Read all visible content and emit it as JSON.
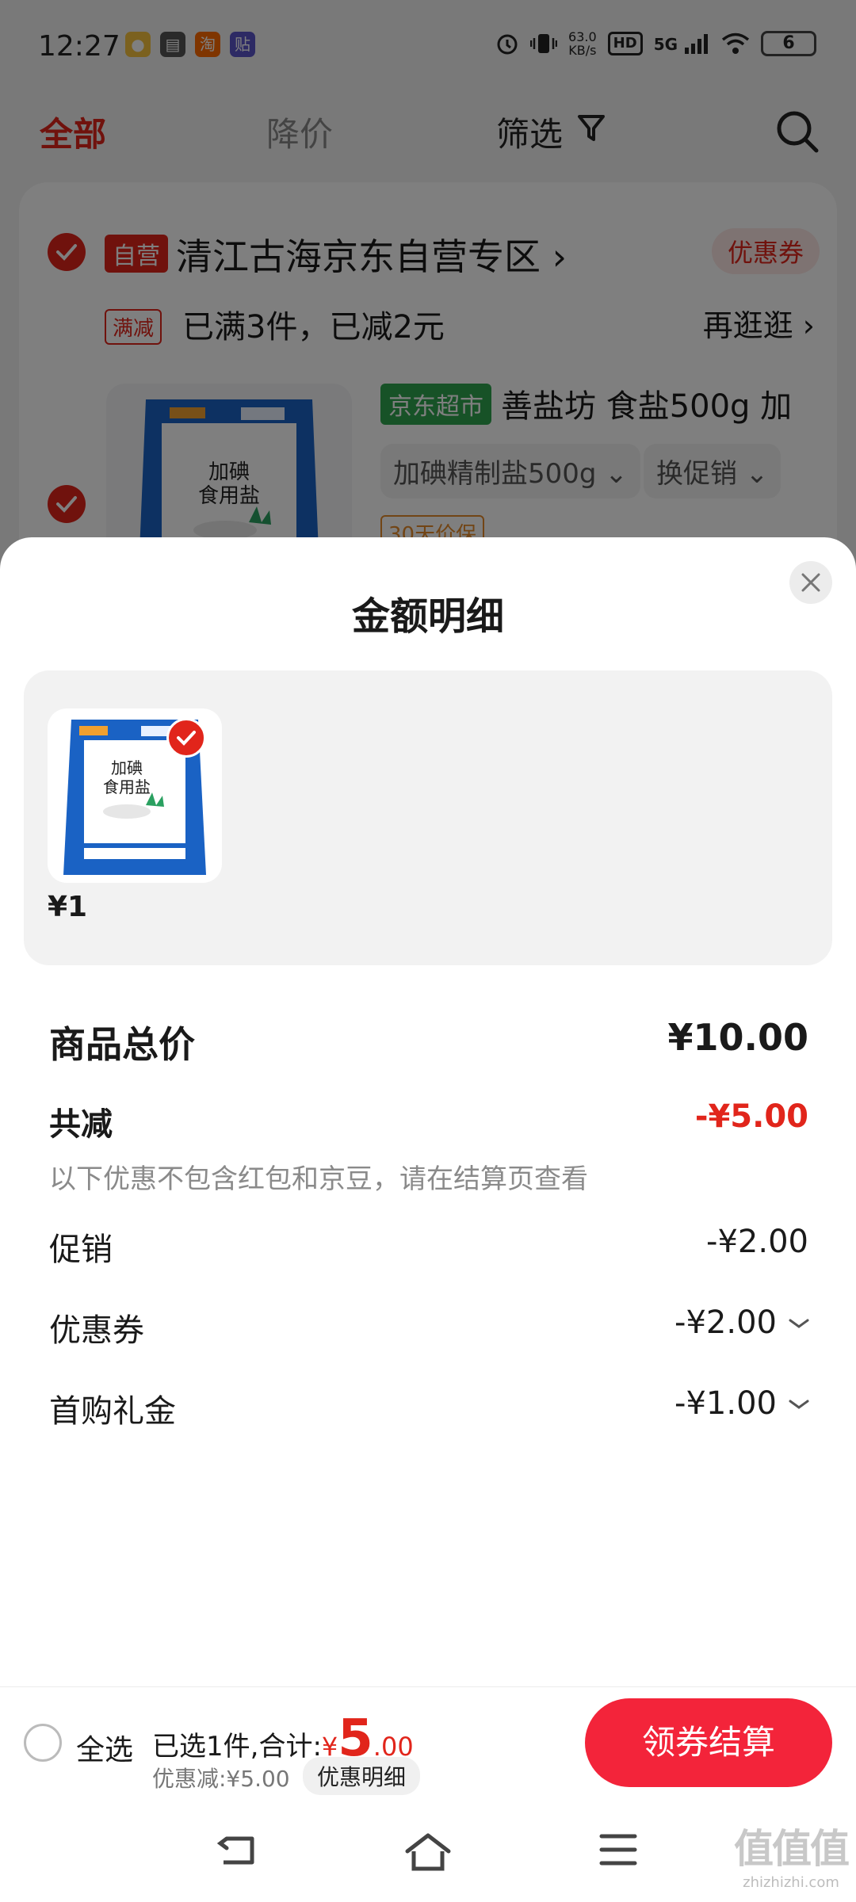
{
  "status_bar": {
    "time": "12:27",
    "net_speed_value": "63.0",
    "net_speed_unit": "KB/s",
    "hd_label": "HD",
    "network_label": "5G",
    "battery": "6"
  },
  "tabs": {
    "all": "全部",
    "price_drop": "降价",
    "filter": "筛选"
  },
  "shop": {
    "tag": "自营",
    "name": "清江古海京东自营专区",
    "coupon": "优惠券",
    "promo_tag": "满减",
    "promo_text": "已满3件，已减2元",
    "more_link": "再逛逛",
    "product_tag": "京东超市",
    "product_name": "善盐坊 食盐500g 加",
    "spec": "加碘精制盐500g",
    "promo_switch": "换促销",
    "guarantee": "30天价保"
  },
  "sheet": {
    "title": "金额明细",
    "item_price": "¥1",
    "total_label": "商品总价",
    "total_value": "¥10.00",
    "reduce_label": "共减",
    "reduce_value": "-¥5.00",
    "note": "以下优惠不包含红包和京豆，请在结算页查看",
    "promo_label": "促销",
    "promo_value": "-¥2.00",
    "coupon_label": "优惠券",
    "coupon_value": "-¥2.00",
    "gift_label": "首购礼金",
    "gift_value": "-¥1.00"
  },
  "bottom_bar": {
    "select_all": "全选",
    "selected_text": "已选1件,合计:",
    "currency": "¥",
    "total_int": "5",
    "total_dec": ".00",
    "discount_text": "优惠减:¥5.00",
    "detail_button": "优惠明细",
    "checkout_button": "领券结算"
  },
  "watermark": {
    "big": "值值值",
    "small": "zhizhizhi.com"
  },
  "colors": {
    "accent": "#e1251b",
    "checkout": "#f3243a",
    "supermarket": "#2ea44f",
    "guarantee": "#e58a2a"
  }
}
